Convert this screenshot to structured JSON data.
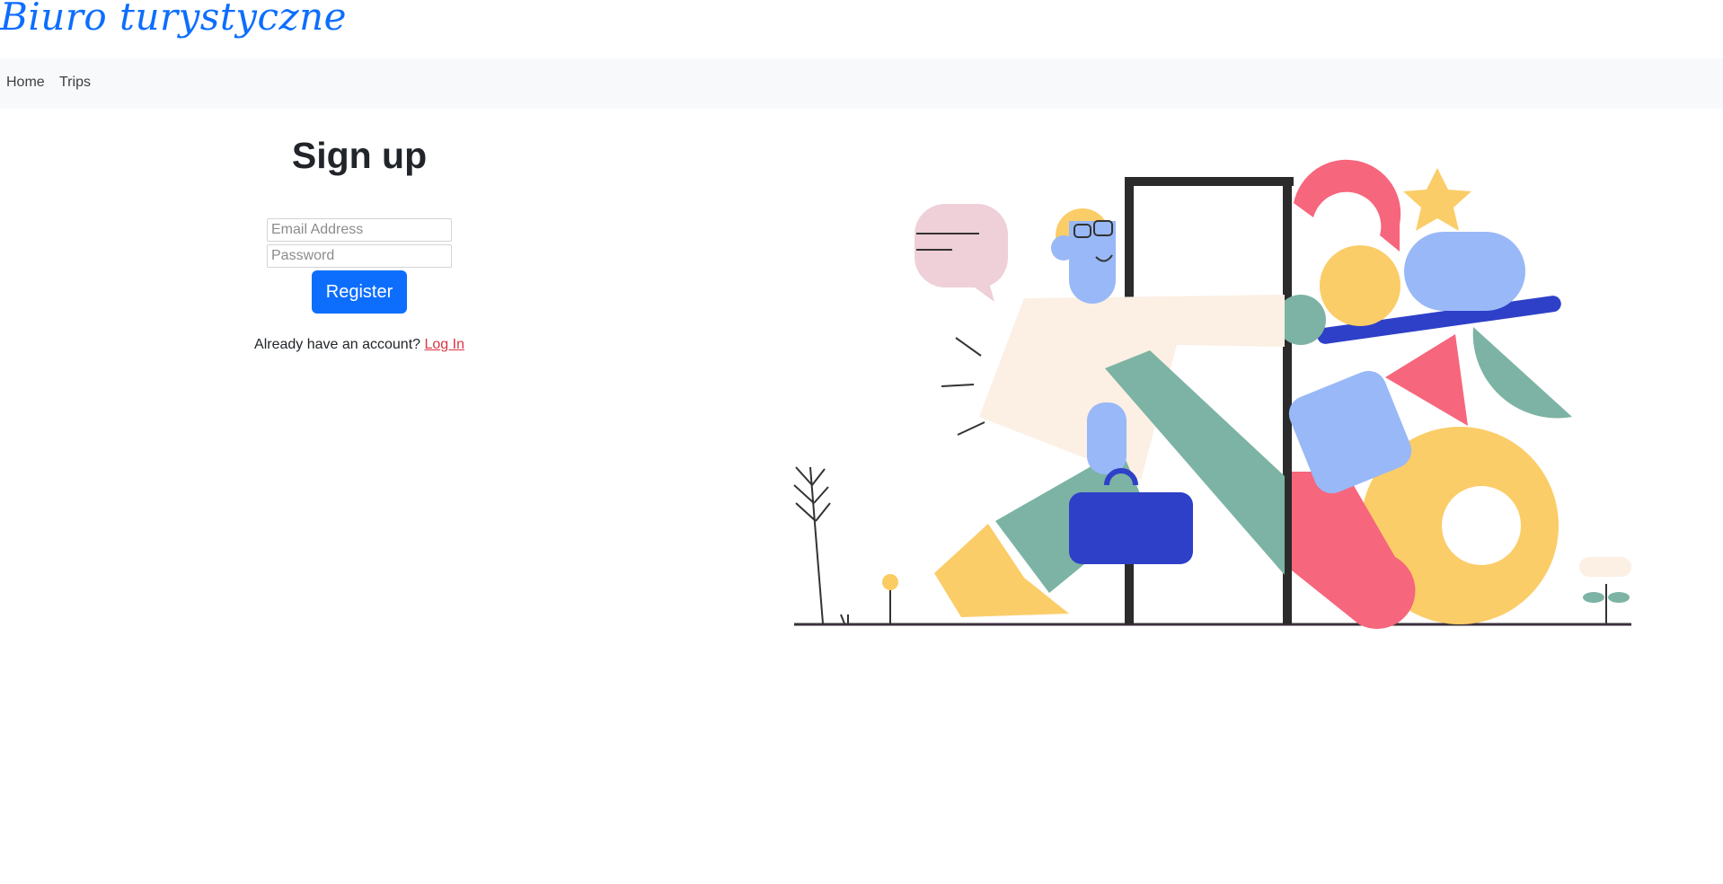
{
  "header": {
    "brand": "Biuro turystyczne"
  },
  "nav": {
    "items": [
      {
        "label": "Home"
      },
      {
        "label": "Trips"
      }
    ]
  },
  "form": {
    "title": "Sign up",
    "email_placeholder": "Email Address",
    "password_placeholder": "Password",
    "register_label": "Register",
    "login_prompt": "Already have an account?",
    "login_link": "Log In"
  },
  "colors": {
    "brand": "#0d6efd",
    "button": "#0d6efd",
    "link": "#dc3545",
    "navbar_bg": "#f8f9fa"
  }
}
